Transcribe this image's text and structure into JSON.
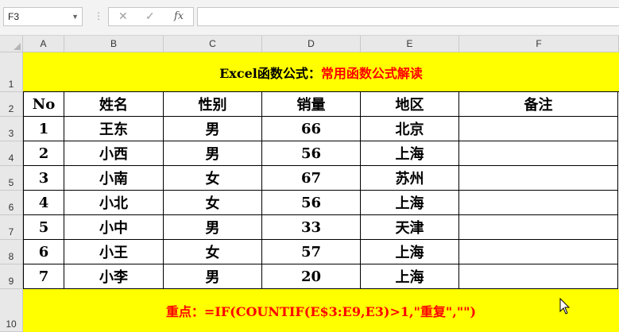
{
  "formula_bar": {
    "name_box": "F3",
    "cancel_glyph": "✕",
    "enter_glyph": "✓",
    "fx_label": "fx",
    "formula": ""
  },
  "columns": [
    "A",
    "B",
    "C",
    "D",
    "E",
    "F"
  ],
  "rows": [
    "1",
    "2",
    "3",
    "4",
    "5",
    "6",
    "7",
    "8",
    "9",
    "10"
  ],
  "title": {
    "black": "Excel函数公式：",
    "red": "常用函数公式解读"
  },
  "table": {
    "headers": [
      "No",
      "姓名",
      "性别",
      "销量",
      "地区",
      "备注"
    ],
    "rows": [
      [
        "1",
        "王东",
        "男",
        "66",
        "北京",
        ""
      ],
      [
        "2",
        "小西",
        "男",
        "56",
        "上海",
        ""
      ],
      [
        "3",
        "小南",
        "女",
        "67",
        "苏州",
        ""
      ],
      [
        "4",
        "小北",
        "女",
        "56",
        "上海",
        ""
      ],
      [
        "5",
        "小中",
        "男",
        "33",
        "天津",
        ""
      ],
      [
        "6",
        "小王",
        "女",
        "57",
        "上海",
        ""
      ],
      [
        "7",
        "小李",
        "男",
        "20",
        "上海",
        ""
      ]
    ]
  },
  "note": {
    "label": "重点：",
    "formula": "=IF(COUNTIF(E$3:E9,E3)>1,\"重复\",\"\")"
  },
  "colors": {
    "highlight": "#ffff00",
    "accent_text": "#ff0000"
  }
}
